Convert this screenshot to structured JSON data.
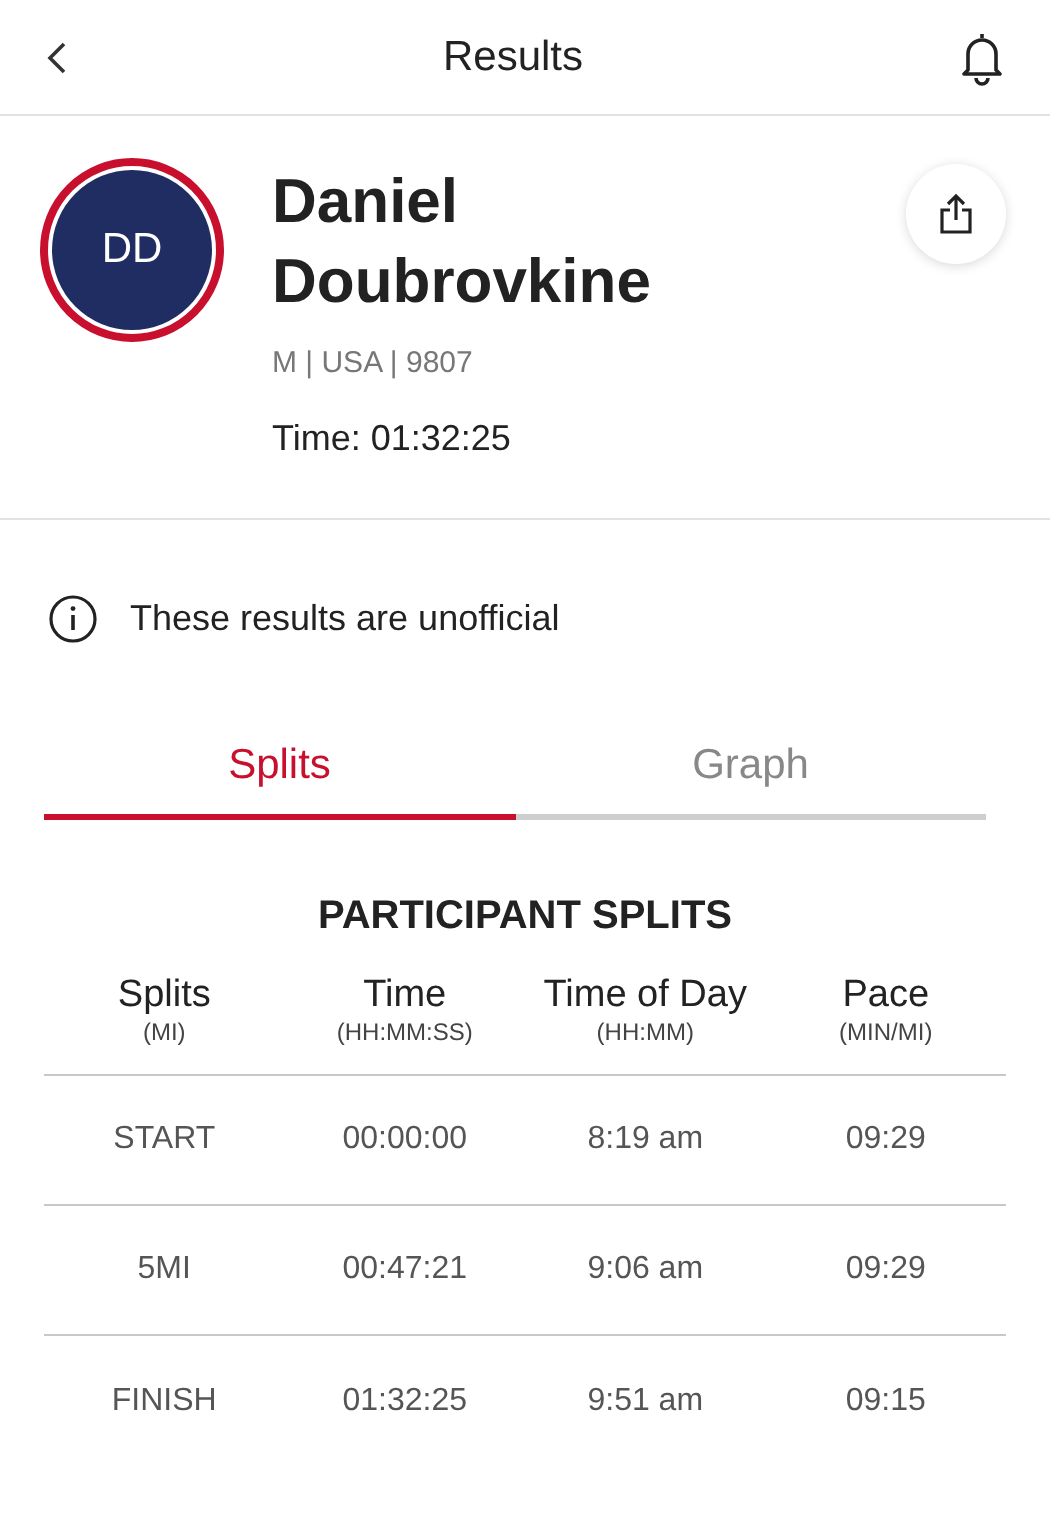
{
  "header": {
    "title": "Results"
  },
  "profile": {
    "initials": "DD",
    "name": "Daniel Doubrovkine",
    "meta": "M | USA | 9807",
    "time": "Time: 01:32:25"
  },
  "notice": "These results are unofficial",
  "tabs": [
    {
      "label": "Splits",
      "selected": true
    },
    {
      "label": "Graph",
      "selected": false
    }
  ],
  "splits": {
    "title": "PARTICIPANT SPLITS",
    "columns": [
      {
        "label": "Splits",
        "unit": "(MI)"
      },
      {
        "label": "Time",
        "unit": "(HH:MM:SS)"
      },
      {
        "label": "Time of Day",
        "unit": "(HH:MM)"
      },
      {
        "label": "Pace",
        "unit": "(MIN/MI)"
      }
    ],
    "rows": [
      [
        "START",
        "00:00:00",
        "8:19 am",
        "09:29"
      ],
      [
        "5MI",
        "00:47:21",
        "9:06 am",
        "09:29"
      ],
      [
        "FINISH",
        "01:32:25",
        "9:51 am",
        "09:15"
      ]
    ]
  }
}
